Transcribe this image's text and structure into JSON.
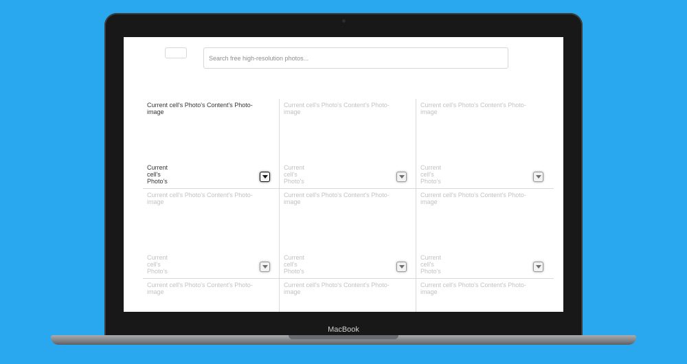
{
  "device": {
    "brand_label": "MacBook"
  },
  "header": {
    "search": {
      "placeholder": "Search free high-resolution photos..."
    }
  },
  "grid": {
    "active_cell": 0,
    "cells": [
      {
        "caption": "Current cell's Photo's Content's Photo-image",
        "meta_line1": "Current",
        "meta_line2": "cell's",
        "meta_line3": "Photo's",
        "action_icon": "download-arrow-icon"
      },
      {
        "caption": "Current cell's Photo's Content's Photo-image",
        "meta_line1": "Current",
        "meta_line2": "cell's",
        "meta_line3": "Photo's",
        "action_icon": "download-arrow-icon"
      },
      {
        "caption": "Current cell's Photo's Content's Photo-image",
        "meta_line1": "Current",
        "meta_line2": "cell's",
        "meta_line3": "Photo's",
        "action_icon": "download-arrow-icon"
      },
      {
        "caption": "Current cell's Photo's Content's Photo-image",
        "meta_line1": "Current",
        "meta_line2": "cell's",
        "meta_line3": "Photo's",
        "action_icon": "download-arrow-icon"
      },
      {
        "caption": "Current cell's Photo's Content's Photo-image",
        "meta_line1": "Current",
        "meta_line2": "cell's",
        "meta_line3": "Photo's",
        "action_icon": "download-arrow-icon"
      },
      {
        "caption": "Current cell's Photo's Content's Photo-image",
        "meta_line1": "Current",
        "meta_line2": "cell's",
        "meta_line3": "Photo's",
        "action_icon": "download-arrow-icon"
      },
      {
        "caption": "Current cell's Photo's Content's Photo-image"
      },
      {
        "caption": "Current cell's Photo's Content's Photo-image"
      },
      {
        "caption": "Current cell's Photo's Content's Photo-image"
      }
    ]
  },
  "colors": {
    "background": "#29a7ef",
    "active_text": "#333333",
    "inactive_text": "#c2c2c2"
  }
}
